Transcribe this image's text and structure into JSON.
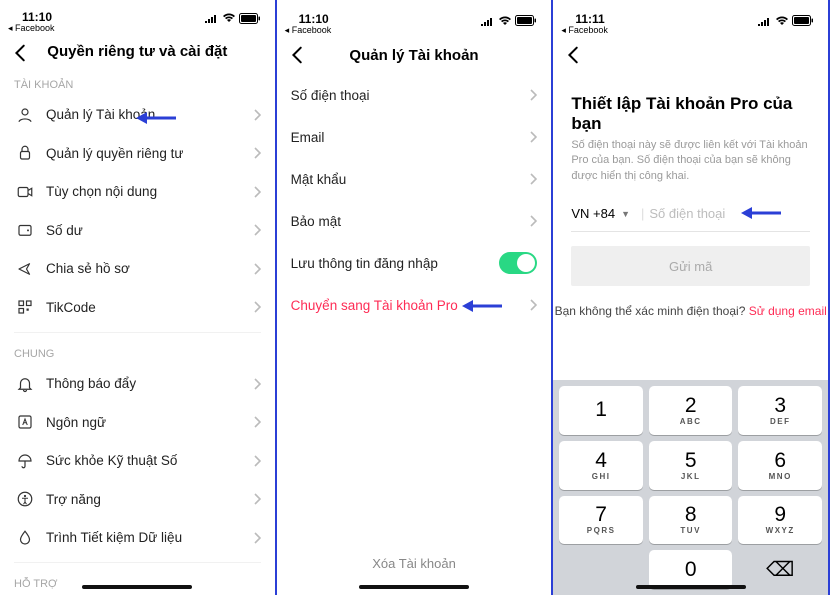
{
  "status": {
    "time1": "11:10",
    "time2": "11:10",
    "time3": "11:11",
    "source": "Facebook"
  },
  "screen1": {
    "title": "Quyền riêng tư và cài đặt",
    "sec_account": "TÀI KHOẢN",
    "sec_general": "CHUNG",
    "sec_support": "HỖ TRỢ",
    "items": {
      "manage": "Quản lý Tài khoản",
      "privacy": "Quản lý quyền riêng tư",
      "content": "Tùy chọn nội dung",
      "balance": "Số dư",
      "share": "Chia sẻ hồ sơ",
      "tikcode": "TikCode",
      "push": "Thông báo đẩy",
      "lang": "Ngôn ngữ",
      "wellbeing": "Sức khỏe Kỹ thuật Số",
      "access": "Trợ năng",
      "saver": "Trình Tiết kiệm Dữ liệu"
    }
  },
  "screen2": {
    "title": "Quản lý Tài khoản",
    "items": {
      "phone": "Số điện thoại",
      "email": "Email",
      "password": "Mật khẩu",
      "security": "Bảo mật",
      "savelogin": "Lưu thông tin đăng nhập",
      "pro": "Chuyển sang Tài khoản Pro"
    },
    "delete": "Xóa Tài khoản"
  },
  "screen3": {
    "title": "Thiết lập Tài khoản Pro của bạn",
    "subtitle": "Số điện thoại này sẽ được liên kết với Tài khoản Pro của bạn. Số điện thoại của bạn sẽ không được hiển thị công khai.",
    "cc": "VN +84",
    "placeholder": "Số điện thoại",
    "send": "Gửi mã",
    "cant": "Bạn không thể xác minh điện thoại? ",
    "use_email": "Sử dụng email",
    "keys": [
      {
        "n": "1",
        "s": ""
      },
      {
        "n": "2",
        "s": "ABC"
      },
      {
        "n": "3",
        "s": "DEF"
      },
      {
        "n": "4",
        "s": "GHI"
      },
      {
        "n": "5",
        "s": "JKL"
      },
      {
        "n": "6",
        "s": "MNO"
      },
      {
        "n": "7",
        "s": "PQRS"
      },
      {
        "n": "8",
        "s": "TUV"
      },
      {
        "n": "9",
        "s": "WXYZ"
      },
      {
        "n": "",
        "s": ""
      },
      {
        "n": "0",
        "s": ""
      },
      {
        "n": "⌫",
        "s": ""
      }
    ]
  }
}
